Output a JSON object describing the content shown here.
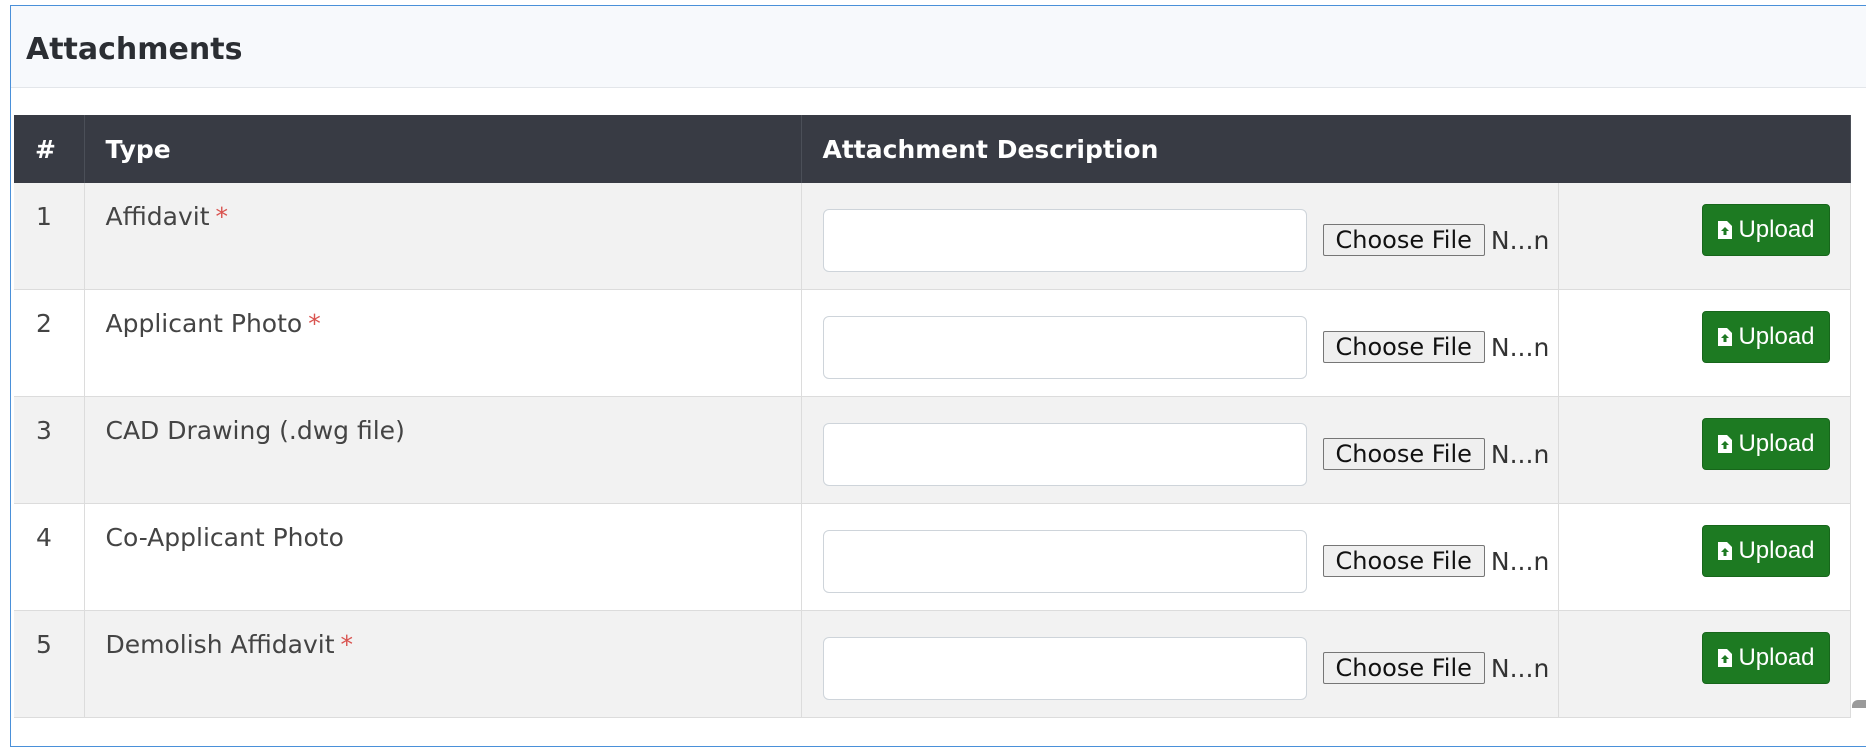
{
  "panel": {
    "title": "Attachments"
  },
  "table": {
    "headers": {
      "num": "#",
      "type": "Type",
      "description": "Attachment Description"
    },
    "rows": [
      {
        "num": "1",
        "type": "Affidavit",
        "required": "*",
        "description": "",
        "choose_label": "Choose File",
        "file_name": "N...n",
        "upload_label": "Upload"
      },
      {
        "num": "2",
        "type": "Applicant Photo",
        "required": "*",
        "description": "",
        "choose_label": "Choose File",
        "file_name": "N...n",
        "upload_label": "Upload"
      },
      {
        "num": "3",
        "type": "CAD Drawing (.dwg file)",
        "required": "",
        "description": "",
        "choose_label": "Choose File",
        "file_name": "N...n",
        "upload_label": "Upload"
      },
      {
        "num": "4",
        "type": "Co-Applicant Photo",
        "required": "",
        "description": "",
        "choose_label": "Choose File",
        "file_name": "N...n",
        "upload_label": "Upload"
      },
      {
        "num": "5",
        "type": "Demolish Affidavit",
        "required": "*",
        "description": "",
        "choose_label": "Choose File",
        "file_name": "N...n",
        "upload_label": "Upload"
      }
    ]
  },
  "icons": {
    "upload": "file-upload-icon"
  },
  "colors": {
    "header_bg": "#383b44",
    "upload_bg": "#1d7a22",
    "required": "#d9534f",
    "card_border": "#4a90d9"
  }
}
